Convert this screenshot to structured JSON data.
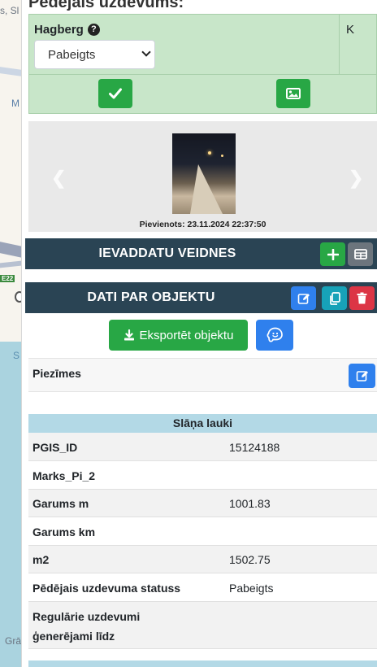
{
  "map": {
    "labels": [
      "s, Sl",
      "M",
      "E22",
      "S",
      "Grā"
    ]
  },
  "header": {
    "title": "Pēdējais uzdevums:"
  },
  "last_task": {
    "assignee": "Hagberg",
    "help_icon": "question-circle-icon",
    "second_column_header": "K",
    "status_value": "Pabeigts",
    "confirm_icon": "check-icon",
    "image_icon": "image-icon"
  },
  "gallery": {
    "prev_icon": "chevron-left-icon",
    "next_icon": "chevron-right-icon",
    "added_text": "Pievienots: 23.11.2024 22:37:50"
  },
  "templates_section": {
    "title": "IEVADDATU VEIDNES",
    "add_icon": "plus-icon",
    "table_icon": "table-icon"
  },
  "object_section": {
    "title": "DATI PAR OBJEKTU",
    "edit_icon": "edit-icon",
    "copy_icon": "copy-icon",
    "delete_icon": "trash-icon",
    "export_label": "Eksportēt objektu",
    "export_icon": "download-icon",
    "waze_icon": "waze-icon"
  },
  "notes": {
    "label": "Piezīmes",
    "edit_icon": "edit-icon"
  },
  "layer_fields": {
    "title": "Slāņa lauki",
    "rows": [
      {
        "key": "PGIS_ID",
        "value": "15124188"
      },
      {
        "key": "Marks_Pi_2",
        "value": ""
      },
      {
        "key": "Garums m",
        "value": "1001.83"
      },
      {
        "key": "Garums km",
        "value": ""
      },
      {
        "key": "m2",
        "value": "1502.75"
      },
      {
        "key": "Pēdējais uzdevuma statuss",
        "value": "Pabeigts"
      },
      {
        "key_line1": "Regulārie uzdevumi",
        "key_line2": "ģenerējami līdz",
        "value": ""
      }
    ]
  },
  "colors": {
    "success": "#28a745",
    "primary": "#2f80ed",
    "info": "#17a2b8",
    "danger": "#dc3545",
    "secondary": "#6c757d",
    "section_bar": "#2a4454",
    "status_bg": "#c8e6c9",
    "layer_head": "#b3d9e6"
  }
}
